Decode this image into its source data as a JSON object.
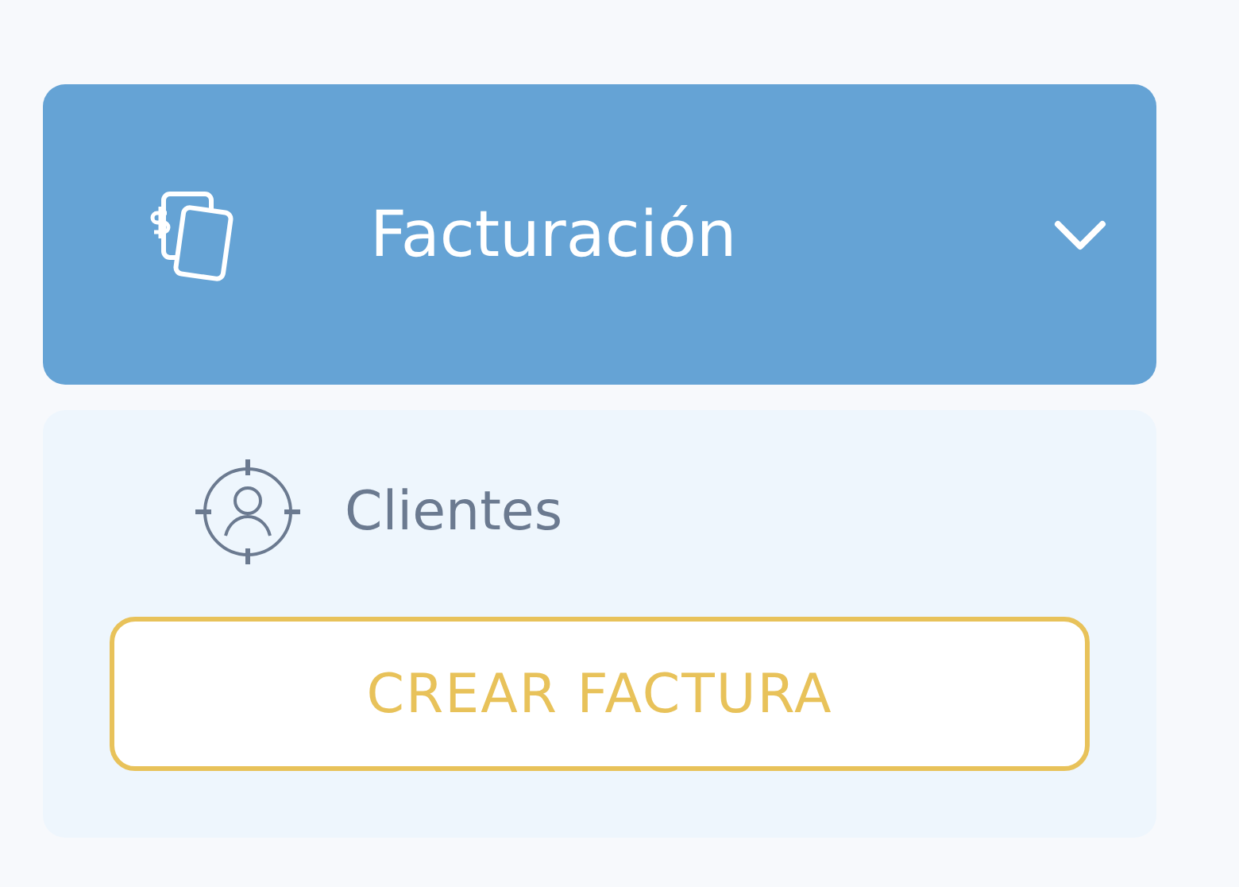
{
  "menu": {
    "title": "Facturación",
    "expanded": true
  },
  "items": [
    {
      "label": "Clientes"
    }
  ],
  "action_button": {
    "label": "CREAR FACTURA"
  }
}
